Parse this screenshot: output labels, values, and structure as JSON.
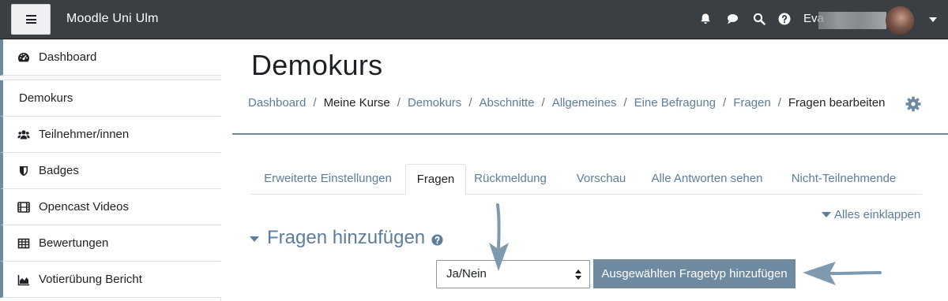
{
  "navbar": {
    "menu_icon": "hamburger-icon",
    "site_name": "Moodle Uni Ulm",
    "icons": [
      "bell-icon",
      "chat-icon",
      "search-icon",
      "help-icon"
    ],
    "user_name": "Eva",
    "user_menu_icon": "chevron-down-icon"
  },
  "sidebar": {
    "items": [
      {
        "label": "Dashboard",
        "icon": "dashboard-icon"
      },
      {
        "label": "Demokurs",
        "icon": ""
      },
      {
        "label": "Teilnehmer/innen",
        "icon": "users-icon"
      },
      {
        "label": "Badges",
        "icon": "shield-icon"
      },
      {
        "label": "Opencast Videos",
        "icon": "film-icon"
      },
      {
        "label": "Bewertungen",
        "icon": "table-icon"
      },
      {
        "label": "Votierübung Bericht",
        "icon": "area-chart-icon"
      }
    ]
  },
  "main": {
    "title": "Demokurs",
    "breadcrumb": [
      "Dashboard",
      "Meine Kurse",
      "Demokurs",
      "Abschnitte",
      "Allgemeines",
      "Eine Befragung",
      "Fragen",
      "Fragen bearbeiten"
    ],
    "settings_icon": "gear-icon",
    "tabs": [
      {
        "label": "Erweiterte Einstellungen",
        "active": false
      },
      {
        "label": "Fragen",
        "active": true
      },
      {
        "label": "Rückmeldung",
        "active": false
      },
      {
        "label": "Vorschau",
        "active": false
      },
      {
        "label": "Alle Antworten sehen",
        "active": false
      },
      {
        "label": "Nicht-Teilnehmende",
        "active": false
      }
    ],
    "collapse_all": "Alles einklappen",
    "section_title": "Fragen hinzufügen",
    "question_type_select": {
      "selected": "Ja/Nein"
    },
    "add_button": "Ausgewählten Fragetyp hinzufügen"
  },
  "colors": {
    "navbar": "#3a3f44",
    "link": "#5b7e9b",
    "accent": "#6e8aa0",
    "annotation_arrow": "#7f9aaf"
  }
}
